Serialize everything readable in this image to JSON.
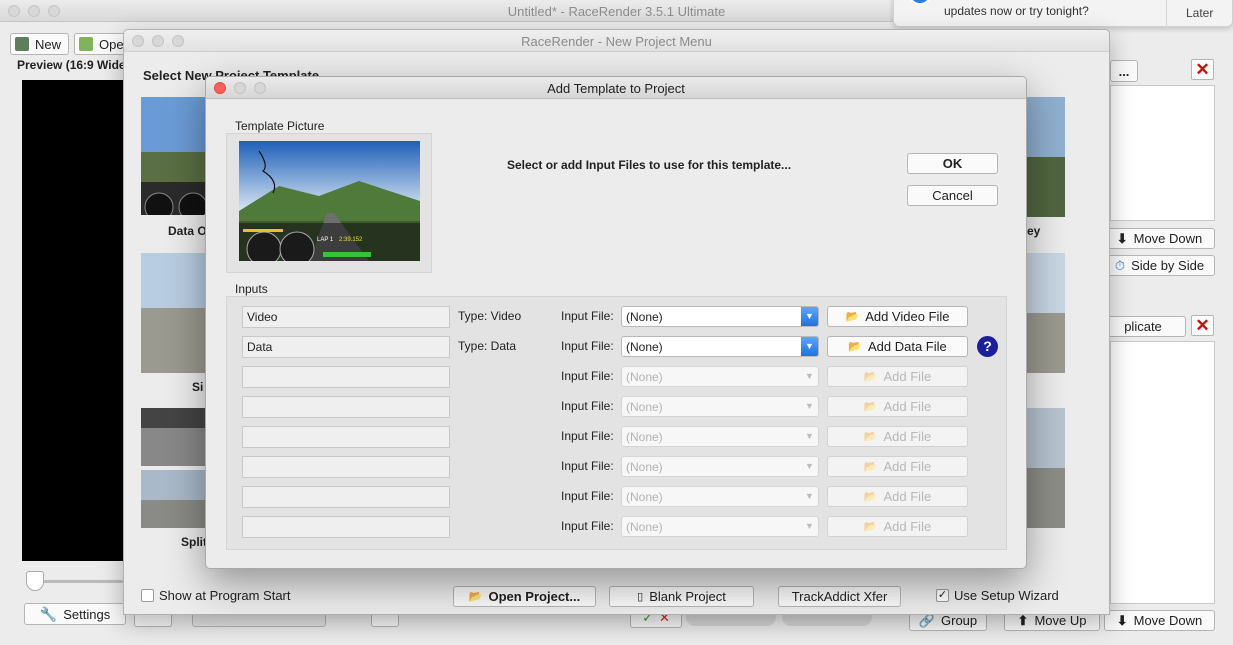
{
  "main_window": {
    "title": "Untitled* - RaceRender 3.5.1 Ultimate",
    "toolbar": {
      "new_label": "New",
      "open_label": "Ope"
    },
    "preview_label": "Preview (16:9 Wide",
    "settings_label": "Settings",
    "right_panel": {
      "more_label": "...",
      "move_down_label": "Move Down",
      "side_by_side_label": "Side by Side",
      "duplicate_label": "plicate",
      "group_label": "Group",
      "move_up_label": "Move Up",
      "move_down_bottom_label": "Move Down"
    }
  },
  "notification": {
    "text": "updates now or try tonight?",
    "later_label": "Later"
  },
  "project_menu": {
    "title": "RaceRender - New Project Menu",
    "heading": "Select New Project Template",
    "template_labels": [
      "Data O",
      "Si",
      "Split"
    ],
    "right_template_label": "ey",
    "show_at_start_label": "Show at Program Start",
    "open_project_label": "Open Project...",
    "blank_project_label": "Blank Project",
    "trackaddict_label": "TrackAddict Xfer",
    "use_wizard_label": "Use Setup Wizard",
    "use_wizard_checked": true,
    "show_at_start_checked": false
  },
  "dialog": {
    "title": "Add Template to Project",
    "template_picture_label": "Template Picture",
    "prompt": "Select or add Input Files to use for this template...",
    "ok_label": "OK",
    "cancel_label": "Cancel",
    "inputs_label": "Inputs",
    "input_file_label": "Input File:",
    "none_option": "(None)",
    "thumb_text": {
      "lap": "LAP 1",
      "time": "2:39.152"
    },
    "rows": [
      {
        "name": "Video",
        "type": "Type: Video",
        "button": "Add Video File",
        "enabled": true
      },
      {
        "name": "Data",
        "type": "Type: Data",
        "button": "Add Data File",
        "enabled": true
      },
      {
        "name": "",
        "type": "",
        "button": "Add File",
        "enabled": false
      },
      {
        "name": "",
        "type": "",
        "button": "Add File",
        "enabled": false
      },
      {
        "name": "",
        "type": "",
        "button": "Add File",
        "enabled": false
      },
      {
        "name": "",
        "type": "",
        "button": "Add File",
        "enabled": false
      },
      {
        "name": "",
        "type": "",
        "button": "Add File",
        "enabled": false
      },
      {
        "name": "",
        "type": "",
        "button": "Add File",
        "enabled": false
      }
    ],
    "help_label": "?"
  },
  "colors": {
    "accent": "#1c73e4",
    "close_red": "#fc605c",
    "delete_red": "#e00000",
    "help_blue": "#1b1f9c"
  }
}
